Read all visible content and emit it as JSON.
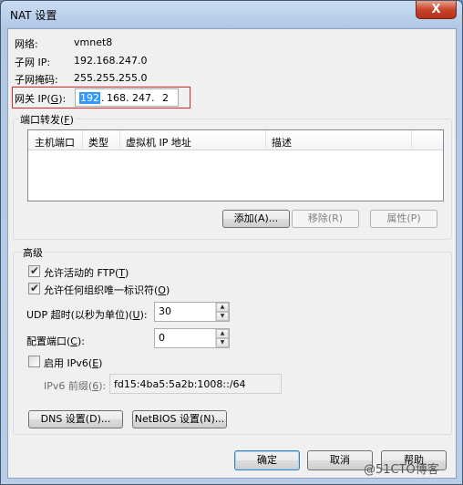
{
  "window": {
    "title": "NAT 设置",
    "close_glyph": "X"
  },
  "info": {
    "network_label": "网络:",
    "network_value": "vmnet8",
    "subnet_ip_label": "子网 IP:",
    "subnet_ip_value": "192.168.247.0",
    "subnet_mask_label": "子网掩码:",
    "subnet_mask_value": "255.255.255.0"
  },
  "gateway": {
    "label_prefix": "网关 IP(",
    "label_key": "G",
    "label_suffix": "):",
    "ip": {
      "seg1": "192",
      "seg2": "168",
      "seg3": "247",
      "seg4": "2",
      "dot": "."
    }
  },
  "port_forwarding": {
    "title_prefix": "端口转发(",
    "title_key": "F",
    "title_suffix": ")",
    "columns": [
      "主机端口",
      "类型",
      "虚拟机 IP 地址",
      "描述"
    ],
    "rows": [],
    "add_button": "添加(A)...",
    "remove_button": "移除(R)",
    "properties_button": "属性(P)"
  },
  "advanced": {
    "title": "高级",
    "allow_ftp": {
      "label_prefix": "允许活动的 FTP(",
      "label_key": "T",
      "label_suffix": ")",
      "checked": true
    },
    "allow_uid": {
      "label_prefix": "允许任何组织唯一标识符(",
      "label_key": "O",
      "label_suffix": ")",
      "checked": true
    },
    "udp_timeout": {
      "label_prefix": "UDP 超时(以秒为单位)(",
      "label_key": "U",
      "label_suffix": "):",
      "value": "30"
    },
    "config_port": {
      "label_prefix": "配置端口(",
      "label_key": "C",
      "label_suffix": "):",
      "value": "0"
    },
    "enable_ipv6": {
      "label_prefix": "启用 IPv6(",
      "label_key": "E",
      "label_suffix": ")",
      "checked": false
    },
    "ipv6_prefix": {
      "label_prefix": "IPv6 前缀(",
      "label_key": "6",
      "label_suffix": "):",
      "value": "fd15:4ba5:5a2b:1008::/64"
    },
    "dns_button": "DNS 设置(D)...",
    "netbios_button": "NetBIOS 设置(N)..."
  },
  "footer": {
    "ok_button": "确定",
    "cancel_button": "取消",
    "help_button": "帮助"
  },
  "watermark": "@51CTO博客"
}
